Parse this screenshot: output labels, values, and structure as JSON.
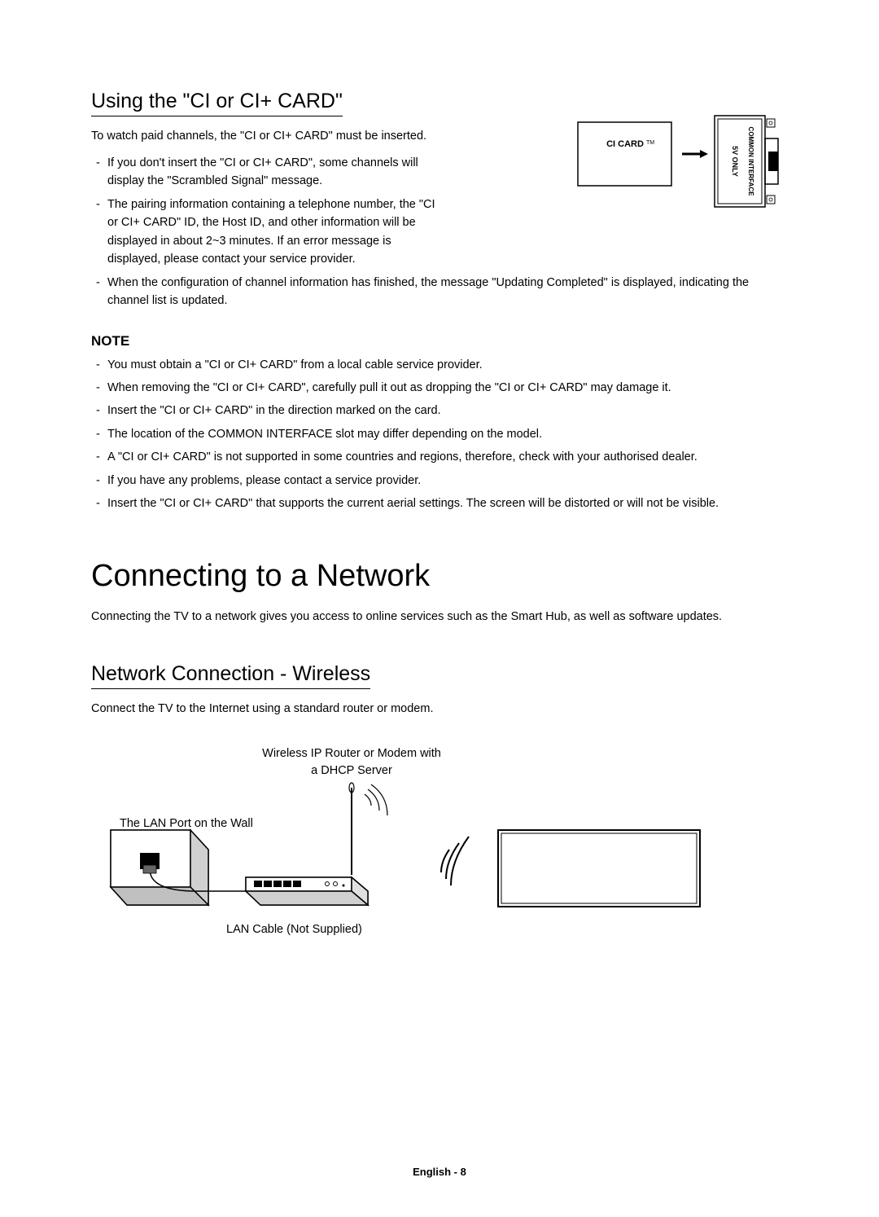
{
  "section1": {
    "title": "Using the \"CI or CI+ CARD\"",
    "intro": "To watch paid channels, the \"CI or CI+ CARD\" must be inserted.",
    "bullets": [
      "If you don't insert the \"CI or CI+ CARD\", some channels will display the \"Scrambled Signal\" message.",
      "The pairing information containing a telephone number, the \"CI or CI+ CARD\" ID, the Host ID, and other information will be displayed in about 2~3 minutes. If an error message is displayed, please contact your service provider.",
      "When the configuration of channel information has finished, the message \"Updating Completed\" is displayed, indicating the channel list is updated."
    ]
  },
  "note": {
    "heading": "NOTE",
    "bullets": [
      "You must obtain a \"CI or CI+ CARD\" from a local cable service provider.",
      "When removing the \"CI or CI+ CARD\", carefully pull it out as dropping the \"CI or CI+ CARD\" may damage it.",
      "Insert the \"CI or CI+ CARD\" in the direction marked on the card.",
      "The location of the COMMON INTERFACE slot may differ depending on the model.",
      "A \"CI or CI+ CARD\" is not supported in some countries and regions, therefore, check with your authorised dealer.",
      "If you have any problems, please contact a service provider.",
      "Insert the \"CI or CI+ CARD\" that supports the current aerial settings. The screen will be distorted or will not be visible."
    ]
  },
  "chapter": {
    "title": "Connecting to a Network",
    "intro": "Connecting the TV to a network gives you access to online services such as the Smart Hub, as well as software updates."
  },
  "section2": {
    "title": "Network Connection - Wireless",
    "intro": "Connect the TV to the Internet using a standard router or modem."
  },
  "diagram": {
    "router_label_line1": "Wireless IP Router or Modem with",
    "router_label_line2": "a DHCP Server",
    "wall_label": "The LAN Port on the Wall",
    "cable_label": "LAN Cable (Not Supplied)",
    "ci_card_label": "CI CARD™",
    "slot_text1": "5V ONLY",
    "slot_text2": "COMMON INTERFACE"
  },
  "footer": "English - 8"
}
